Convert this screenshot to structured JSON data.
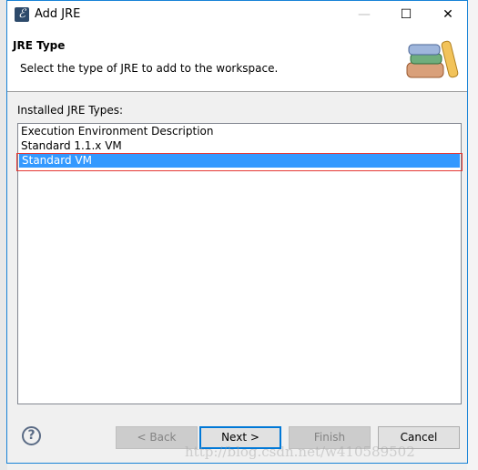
{
  "window": {
    "title": "Add JRE",
    "minimize": "—",
    "maximize": "☐",
    "close": "✕",
    "app_icon": "eclipse-icon"
  },
  "header": {
    "title": "JRE Type",
    "description": "Select the type of JRE to add to the workspace.",
    "image": "books-icon"
  },
  "list": {
    "label": "Installed JRE Types:",
    "items": [
      "Execution Environment Description",
      "Standard 1.1.x VM",
      "Standard VM"
    ],
    "selected": "Standard VM"
  },
  "buttons": {
    "help": "?",
    "back": "< Back",
    "next": "Next >",
    "finish": "Finish",
    "cancel": "Cancel"
  },
  "watermark": "http://blog.csdn.net/w410589502",
  "colors": {
    "selection": "#3399ff",
    "accent": "#0078d7",
    "annotation": "#e53935"
  }
}
